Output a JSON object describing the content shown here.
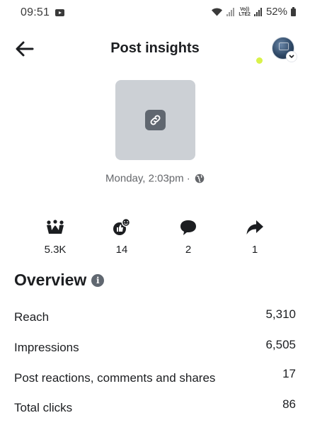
{
  "status_bar": {
    "time": "09:51",
    "battery": "52%",
    "network_label": "VoLTE2"
  },
  "header": {
    "title": "Post insights",
    "back_icon": "arrow-left-icon",
    "avatar_icon": "profile-avatar"
  },
  "post": {
    "thumbnail_icon": "link-icon",
    "timestamp": "Monday, 2:03pm ·",
    "audience_icon": "globe-icon"
  },
  "metrics": [
    {
      "icon": "reach-people-icon",
      "value": "5.3K"
    },
    {
      "icon": "reactions-icon",
      "value": "14"
    },
    {
      "icon": "comment-icon",
      "value": "2"
    },
    {
      "icon": "share-icon",
      "value": "1"
    }
  ],
  "overview": {
    "title": "Overview",
    "rows": [
      {
        "label": "Reach",
        "value": "5,310"
      },
      {
        "label": "Impressions",
        "value": "6,505"
      },
      {
        "label": "Post reactions, comments and shares",
        "value": "17"
      },
      {
        "label": "Total clicks",
        "value": "86"
      }
    ]
  },
  "colors": {
    "text": "#1c1e21",
    "secondary_text": "#65676b",
    "thumbnail_bg": "#ccd0d5",
    "indicator_dot": "#d9f24a"
  }
}
